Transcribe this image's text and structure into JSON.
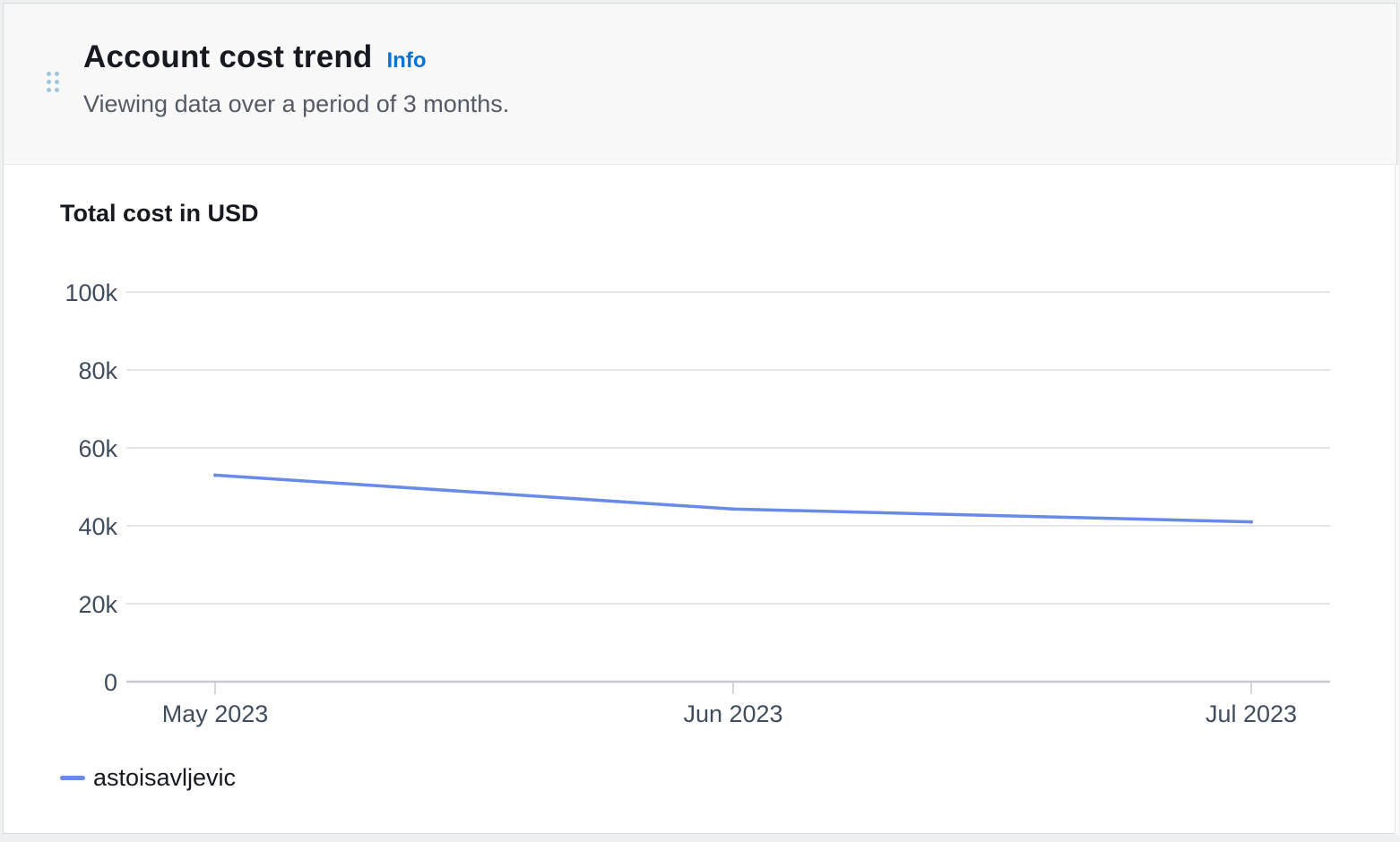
{
  "widget": {
    "title": "Account cost trend",
    "info_label": "Info",
    "subtitle": "Viewing data over a period of 3 months."
  },
  "icons": {
    "drag_handle": "drag-handle-icon"
  },
  "colors": {
    "series": "#688ae8",
    "info_link": "#0972d3",
    "grid": "#d5dbdb",
    "axis_text": "#414d5c"
  },
  "chart_data": {
    "type": "line",
    "title": "Total cost in USD",
    "xlabel": "",
    "ylabel": "",
    "categories": [
      "May 2023",
      "Jun 2023",
      "Jul 2023"
    ],
    "series": [
      {
        "name": "astoisavljevic",
        "values": [
          53000,
          44300,
          41000
        ]
      }
    ],
    "ylim": [
      0,
      100000
    ],
    "yticks": [
      0,
      20000,
      40000,
      60000,
      80000,
      100000
    ],
    "ytick_labels": [
      "0",
      "20k",
      "40k",
      "60k",
      "80k",
      "100k"
    ],
    "grid": true,
    "legend_position": "bottom-left"
  }
}
